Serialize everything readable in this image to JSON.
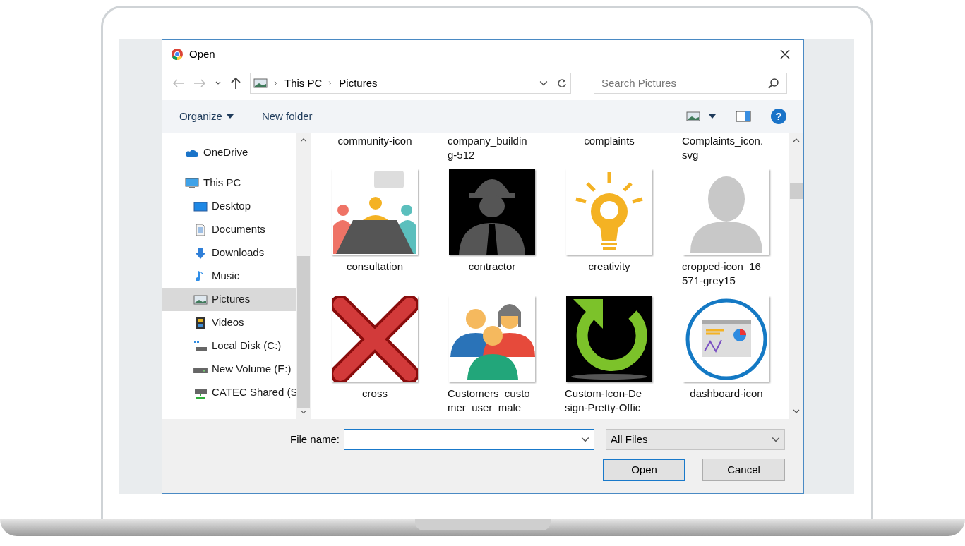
{
  "window": {
    "title": "Open"
  },
  "address_bar": {
    "crumbs": [
      "This PC",
      "Pictures"
    ]
  },
  "search": {
    "placeholder": "Search Pictures"
  },
  "toolbar": {
    "organize": "Organize",
    "new_folder": "New folder",
    "help": "?"
  },
  "nav": [
    {
      "label": "OneDrive",
      "kind": "cloud",
      "selected": false
    },
    {
      "label": "This PC",
      "kind": "pc",
      "selected": false,
      "children": [
        {
          "label": "Desktop",
          "kind": "desktop",
          "selected": false
        },
        {
          "label": "Documents",
          "kind": "documents",
          "selected": false
        },
        {
          "label": "Downloads",
          "kind": "downloads",
          "selected": false
        },
        {
          "label": "Music",
          "kind": "music",
          "selected": false
        },
        {
          "label": "Pictures",
          "kind": "pictures",
          "selected": true
        },
        {
          "label": "Videos",
          "kind": "videos",
          "selected": false
        },
        {
          "label": "Local Disk (C:)",
          "kind": "disk",
          "selected": false
        },
        {
          "label": "New Volume (E:)",
          "kind": "drive",
          "selected": false
        },
        {
          "label": "CATEC Shared (S",
          "kind": "netdrive",
          "selected": false
        }
      ]
    }
  ],
  "files": [
    {
      "lines": [
        "community-icon"
      ]
    },
    {
      "lines": [
        "company_buildin",
        "g-512"
      ]
    },
    {
      "lines": [
        "complaints"
      ]
    },
    {
      "lines": [
        "Complaints_icon.",
        "svg"
      ]
    },
    {
      "lines": [
        "consultation"
      ],
      "kind": "meeting"
    },
    {
      "lines": [
        "contractor"
      ],
      "kind": "worker"
    },
    {
      "lines": [
        "creativity"
      ],
      "kind": "bulb"
    },
    {
      "lines": [
        "cropped-icon_16",
        "571-grey15"
      ],
      "kind": "silhouette"
    },
    {
      "lines": [
        "cross"
      ],
      "kind": "cross"
    },
    {
      "lines": [
        "Customers_custo",
        "mer_user_male_"
      ],
      "kind": "group"
    },
    {
      "lines": [
        "Custom-Icon-De",
        "sign-Pretty-Offic"
      ],
      "kind": "arrow"
    },
    {
      "lines": [
        "dashboard-icon"
      ],
      "kind": "dashboard"
    }
  ],
  "file_name": {
    "label": "File name:"
  },
  "file_type": {
    "value": "All Files"
  },
  "buttons": [
    {
      "label": "Open",
      "kind": "primary"
    },
    {
      "label": "Cancel",
      "kind": "normal"
    }
  ]
}
